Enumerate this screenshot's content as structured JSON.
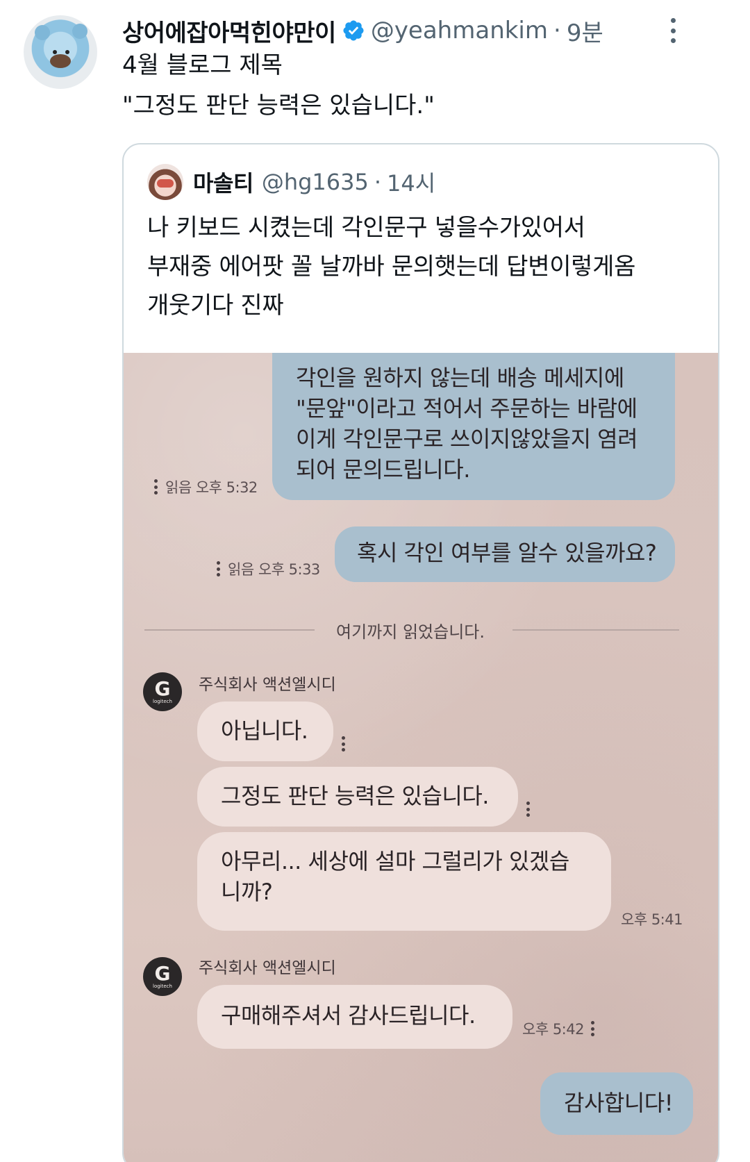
{
  "tweet": {
    "display_name": "상어에잡아먹힌야만이",
    "handle": "@yeahmankim",
    "separator": "·",
    "time": "9분",
    "text_lines": [
      "4월 블로그 제목",
      "\"그정도 판단 능력은 있습니다.\""
    ],
    "verified_icon": "verified-badge-icon",
    "more_icon": "more-vertical-icon",
    "accent_color": "#1d9bf0"
  },
  "quote": {
    "display_name": "마솔티",
    "handle": "@hg1635",
    "separator": "·",
    "time": "14시",
    "text_lines": [
      "나 키보드 시켰는데 각인문구 넣을수가있어서",
      "부재중 에어팟 꼴 날까바 문의햇는데 답변이렇게옴",
      "개웃기다 진짜"
    ]
  },
  "chat": {
    "sent_1": {
      "lines": [
        "각인을 원하지 않는데 배송 메세지에",
        "\"문앞\"이라고 적어서 주문하는 바람에",
        "이게 각인문구로 쓰이지않았을지 염려",
        "되어 문의드립니다."
      ],
      "meta": "읽음 오후 5:32"
    },
    "sent_2": {
      "text": "혹시 각인 여부를 알수 있을까요?",
      "meta": "읽음 오후 5:33"
    },
    "divider": "여기까지 읽었습니다.",
    "sender_name": "주식회사 액션엘시디",
    "logo_letter": "G",
    "logo_sub": "logitech",
    "recv_1": "아닙니다.",
    "recv_2": "그정도 판단 능력은 있습니다.",
    "recv_3": {
      "lines": [
        "아무리... 세상에 설마 그럴리가 있겠습",
        "니까?"
      ],
      "time": "오후 5:41"
    },
    "recv_4": {
      "text": "구매해주셔서 감사드립니다.",
      "time": "오후 5:42"
    },
    "sent_3": "감사합니다!"
  }
}
